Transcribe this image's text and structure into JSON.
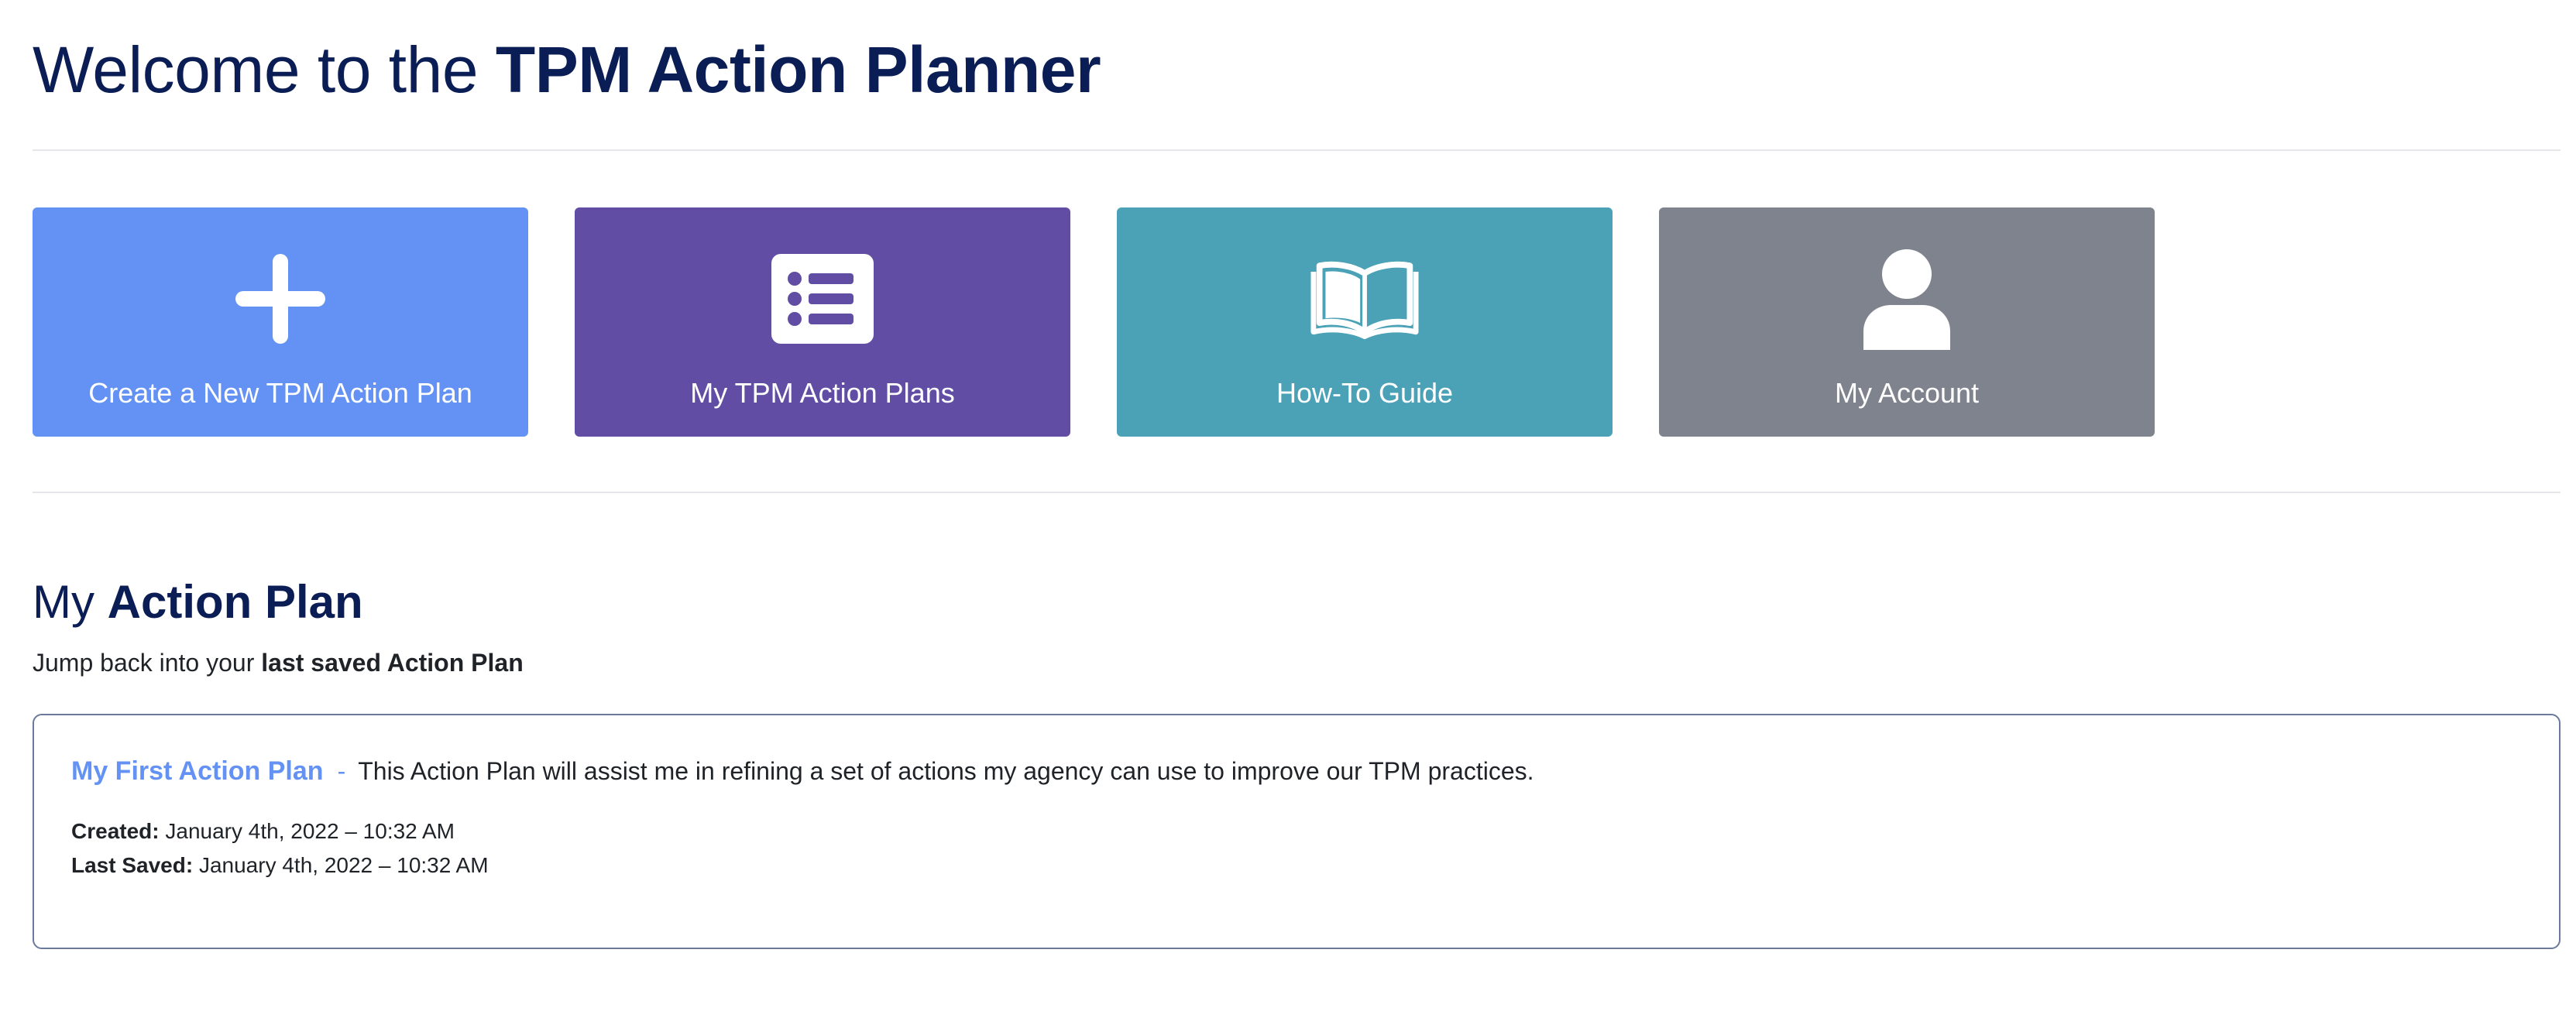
{
  "header": {
    "title_prefix": "Welcome to the",
    "title_bold": "TPM Action Planner"
  },
  "tiles": [
    {
      "label": "Create a New TPM Action Plan",
      "icon": "plus-icon",
      "color": "#6492f4"
    },
    {
      "label": "My TPM Action Plans",
      "icon": "list-icon",
      "color": "#614ea4"
    },
    {
      "label": "How-To Guide",
      "icon": "book-icon",
      "color": "#4ba1b6"
    },
    {
      "label": "My Account",
      "icon": "user-icon",
      "color": "#7f838d"
    }
  ],
  "section": {
    "title_prefix": "My",
    "title_bold": "Action Plan",
    "subtitle_prefix": "Jump back into your",
    "subtitle_bold": "last saved Action Plan"
  },
  "plan": {
    "name": "My First Action Plan",
    "separator": "-",
    "description": "This Action Plan will assist me in refining a set of actions my agency can use to improve our TPM practices.",
    "created_label": "Created:",
    "created_value": "January 4th, 2022 – 10:32 AM",
    "saved_label": "Last Saved:",
    "saved_value": "January 4th, 2022 – 10:32 AM"
  },
  "colors": {
    "heading": "#0b1d55",
    "link": "#6492f4",
    "card_border": "#6b7a9a"
  }
}
